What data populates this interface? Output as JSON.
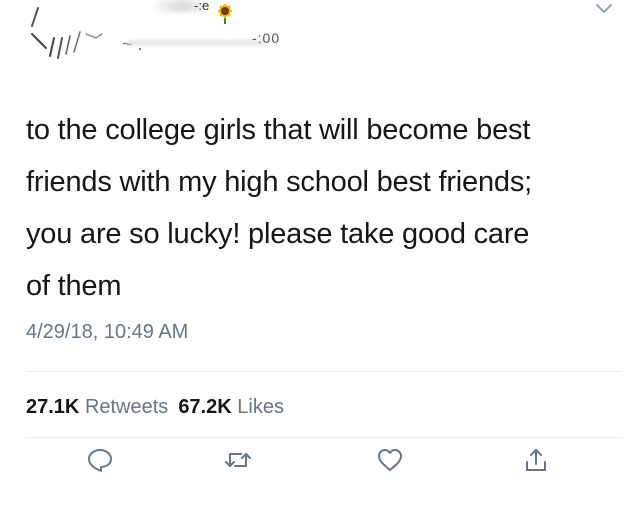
{
  "header": {
    "name_suffix": "-:e",
    "handle_dash": "~ .",
    "handle_suffix": "-:00"
  },
  "tweet": {
    "text_lines": [
      "to the college girls that will become best",
      "friends with my high school best friends;",
      "you are so lucky! please take good care",
      "of them"
    ],
    "timestamp": "4/29/18, 10:49 AM"
  },
  "stats": {
    "retweets_count": "27.1K",
    "retweets_label": "Retweets",
    "likes_count": "67.2K",
    "likes_label": "Likes"
  },
  "actions": {
    "reply_icon": "reply-icon",
    "retweet_icon": "retweet-icon",
    "like_icon": "heart-icon",
    "share_icon": "share-icon"
  },
  "colors": {
    "text": "#14171a",
    "secondary": "#657786",
    "icon": "#657786",
    "divider": "#e6ecf0",
    "sunflower": "#f5b800"
  }
}
